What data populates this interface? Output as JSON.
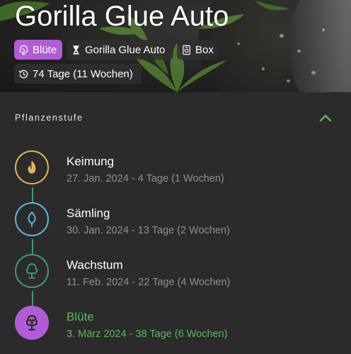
{
  "plant": {
    "title": "Gorilla Glue Auto",
    "stage_chip": "Blüte",
    "strain_chip": "Gorilla Glue Auto",
    "location_chip": "Box",
    "age_chip": "74 Tage (11 Wochen)"
  },
  "section": {
    "title": "Pflanzenstufe"
  },
  "stages": [
    {
      "name": "Keimung",
      "detail": "27. Jan. 2024 - 4 Tage (1 Wochen)",
      "color": "#e3b15c",
      "icon": "flame-sprout-icon"
    },
    {
      "name": "Sämling",
      "detail": "30. Jan. 2024 - 13 Tage (2 Wochen)",
      "color": "#5bb7d9",
      "icon": "seedling-leaf-icon"
    },
    {
      "name": "Wachstum",
      "detail": "11. Feb. 2024 - 22 Tage (4 Wochen)",
      "color": "#3f9a6a",
      "icon": "tree-icon"
    },
    {
      "name": "Blüte",
      "detail": "3. März 2024 - 38 Tage (6 Wochen)",
      "color": "#b05cd6",
      "icon": "flowering-tree-icon"
    }
  ],
  "colors": {
    "accent_green": "#5cb85c",
    "stage_purple": "#b05cd6",
    "background": "#2b2b2b"
  }
}
